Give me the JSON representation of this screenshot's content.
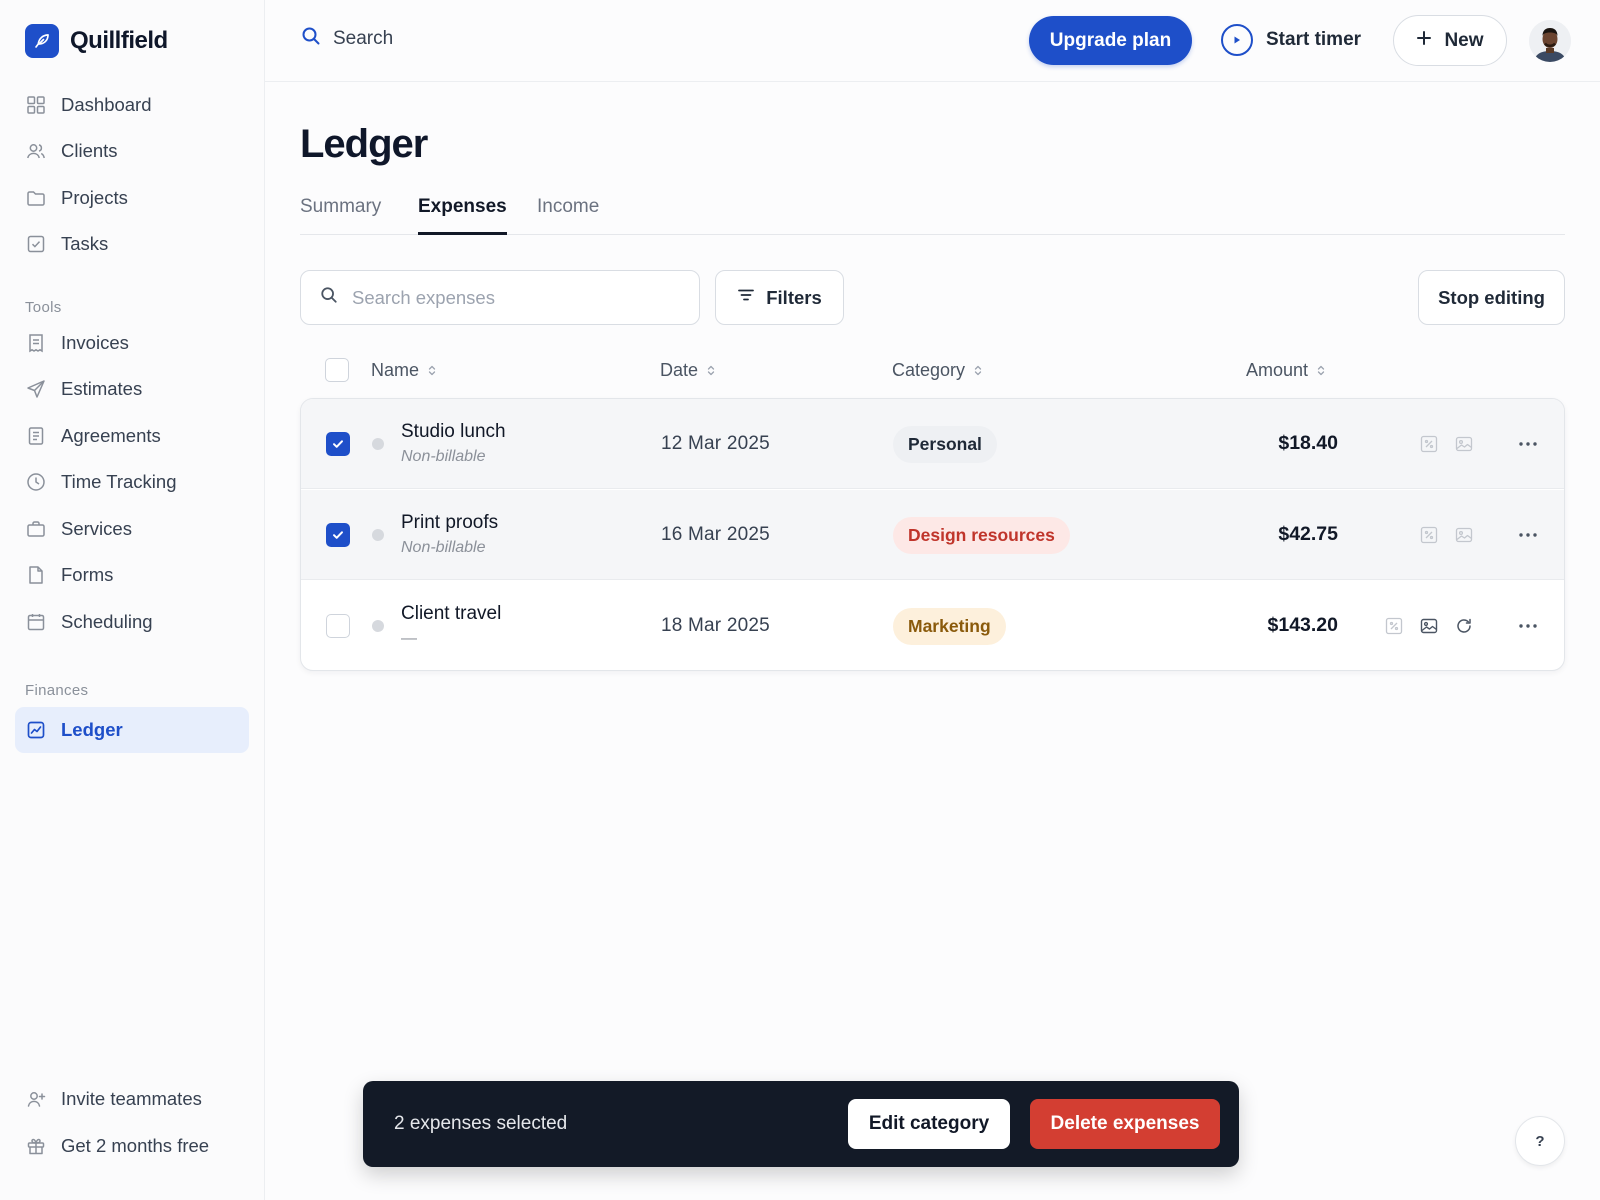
{
  "brand": {
    "name": "Quillfield"
  },
  "sidebar": {
    "main_items": [
      {
        "label": "Dashboard",
        "icon": "grid-icon"
      },
      {
        "label": "Clients",
        "icon": "users-icon"
      },
      {
        "label": "Projects",
        "icon": "folder-icon"
      },
      {
        "label": "Tasks",
        "icon": "checkbox-icon"
      }
    ],
    "tools_label": "Tools",
    "tools_items": [
      {
        "label": "Invoices",
        "icon": "receipt-icon"
      },
      {
        "label": "Estimates",
        "icon": "send-icon"
      },
      {
        "label": "Agreements",
        "icon": "document-icon"
      },
      {
        "label": "Time Tracking",
        "icon": "clock-icon"
      },
      {
        "label": "Services",
        "icon": "briefcase-icon"
      },
      {
        "label": "Forms",
        "icon": "file-icon"
      },
      {
        "label": "Scheduling",
        "icon": "calendar-icon"
      }
    ],
    "finances_label": "Finances",
    "finances_items": [
      {
        "label": "Ledger",
        "icon": "chart-icon",
        "active": true
      }
    ],
    "footer_items": [
      {
        "label": "Invite teammates",
        "icon": "user-plus-icon"
      },
      {
        "label": "Get 2 months free",
        "icon": "gift-icon"
      }
    ]
  },
  "topbar": {
    "search_label": "Search",
    "upgrade_label": "Upgrade plan",
    "timer_label": "Start timer",
    "new_label": "New"
  },
  "page": {
    "title": "Ledger",
    "tabs": [
      {
        "label": "Summary",
        "active": false
      },
      {
        "label": "Expenses",
        "active": true
      },
      {
        "label": "Income",
        "active": false
      }
    ]
  },
  "toolbar": {
    "search_placeholder": "Search expenses",
    "filters_label": "Filters",
    "stop_editing_label": "Stop editing"
  },
  "table": {
    "columns": [
      "Name",
      "Date",
      "Category",
      "Amount"
    ],
    "rows": [
      {
        "name": "Studio lunch",
        "sub": "Non-billable",
        "date": "12 Mar 2025",
        "category": "Personal",
        "category_bg": "#eef0f3",
        "category_fg": "#1f2937",
        "amount": "$18.40",
        "selected": true
      },
      {
        "name": "Print proofs",
        "sub": "Non-billable",
        "date": "16 Mar 2025",
        "category": "Design resources",
        "category_bg": "#fde8e6",
        "category_fg": "#c0352b",
        "amount": "$42.75",
        "selected": true
      },
      {
        "name": "Client travel",
        "sub": "—",
        "date": "18 Mar 2025",
        "category": "Marketing",
        "category_bg": "#fdf0dc",
        "category_fg": "#8a5a0b",
        "amount": "$143.20",
        "selected": false
      }
    ]
  },
  "bulk": {
    "count_text": "2 expenses selected",
    "edit_label": "Edit category",
    "delete_label": "Delete expenses"
  },
  "help": {
    "label": "?"
  },
  "colors": {
    "accent": "#1e4fc9",
    "danger": "#d33e32",
    "bulk_bg": "#131a27"
  }
}
